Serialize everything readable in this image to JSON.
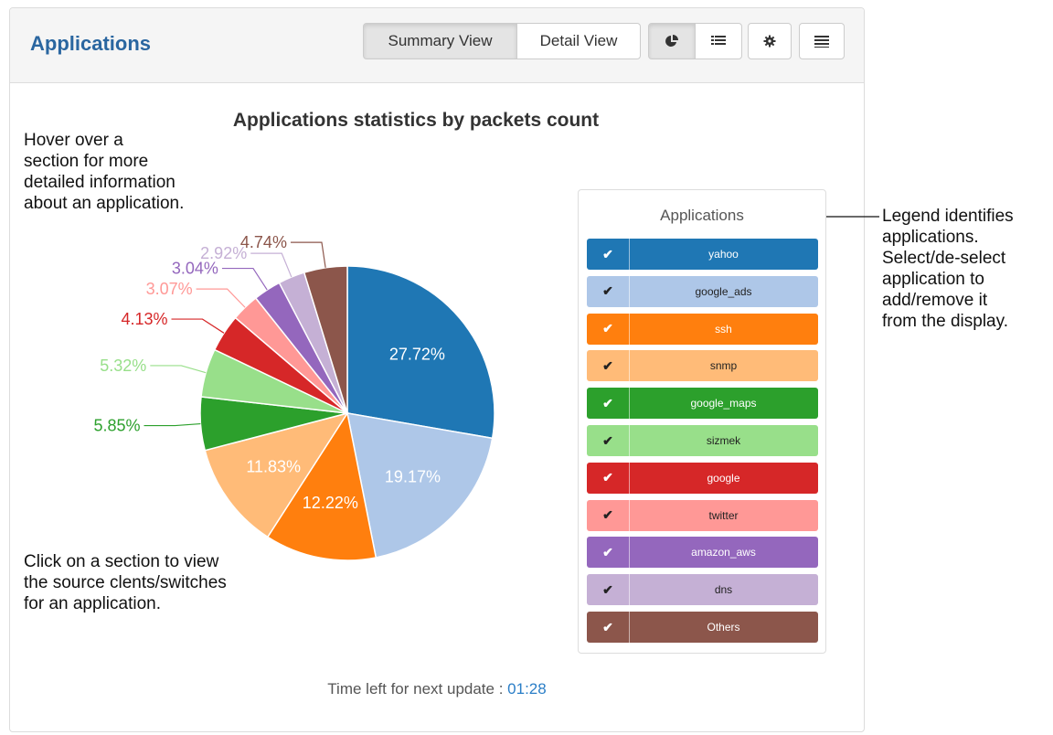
{
  "panel": {
    "title": "Applications",
    "buttons": {
      "summary_view": "Summary View",
      "detail_view": "Detail View"
    },
    "icons": [
      "pie-chart-icon",
      "list-icon",
      "gear-icon",
      "menu-icon"
    ]
  },
  "chart_data": {
    "type": "pie",
    "title": "Applications statistics by packets count",
    "slices": [
      {
        "label": "yahoo",
        "value": 27.72,
        "color": "#1f77b4",
        "label_text": "27.72%"
      },
      {
        "label": "google_ads",
        "value": 19.17,
        "color": "#aec7e8",
        "label_text": "19.17%"
      },
      {
        "label": "ssh",
        "value": 12.22,
        "color": "#ff7f0e",
        "label_text": "12.22%"
      },
      {
        "label": "snmp",
        "value": 11.83,
        "color": "#ffbb78",
        "label_text": "11.83%"
      },
      {
        "label": "google_maps",
        "value": 5.85,
        "color": "#2ca02c",
        "label_text": "5.85%"
      },
      {
        "label": "sizmek",
        "value": 5.32,
        "color": "#98df8a",
        "label_text": "5.32%"
      },
      {
        "label": "google",
        "value": 4.13,
        "color": "#d62728",
        "label_text": "4.13%"
      },
      {
        "label": "twitter",
        "value": 3.07,
        "color": "#ff9896",
        "label_text": "3.07%"
      },
      {
        "label": "amazon_aws",
        "value": 3.04,
        "color": "#9467bd",
        "label_text": "3.04%"
      },
      {
        "label": "dns",
        "value": 2.92,
        "color": "#c5b0d5",
        "label_text": "2.92%"
      },
      {
        "label": "Others",
        "value": 4.74,
        "color": "#8c564b",
        "label_text": "4.74%"
      }
    ]
  },
  "legend": {
    "title": "Applications",
    "check_glyph": "✔",
    "items": [
      {
        "label": "yahoo",
        "color": "#1f77b4",
        "dark_text": false
      },
      {
        "label": "google_ads",
        "color": "#aec7e8",
        "dark_text": true
      },
      {
        "label": "ssh",
        "color": "#ff7f0e",
        "dark_text": false
      },
      {
        "label": "snmp",
        "color": "#ffbb78",
        "dark_text": true
      },
      {
        "label": "google_maps",
        "color": "#2ca02c",
        "dark_text": false
      },
      {
        "label": "sizmek",
        "color": "#98df8a",
        "dark_text": true
      },
      {
        "label": "google",
        "color": "#d62728",
        "dark_text": false
      },
      {
        "label": "twitter",
        "color": "#ff9896",
        "dark_text": true
      },
      {
        "label": "amazon_aws",
        "color": "#9467bd",
        "dark_text": false
      },
      {
        "label": "dns",
        "color": "#c5b0d5",
        "dark_text": true
      },
      {
        "label": "Others",
        "color": "#8c564b",
        "dark_text": false
      }
    ]
  },
  "annotations": {
    "hover": [
      "Hover over a",
      "section for more",
      "detailed information",
      "about an application."
    ],
    "click": [
      "Click on a section to view",
      "the source clents/switches",
      "for an application."
    ],
    "legend": [
      "Legend identifies",
      "applications.",
      "Select/de-select",
      "application to",
      "add/remove it",
      "from the display."
    ]
  },
  "footer": {
    "label": "Time left for next update : ",
    "time": "01:28"
  }
}
